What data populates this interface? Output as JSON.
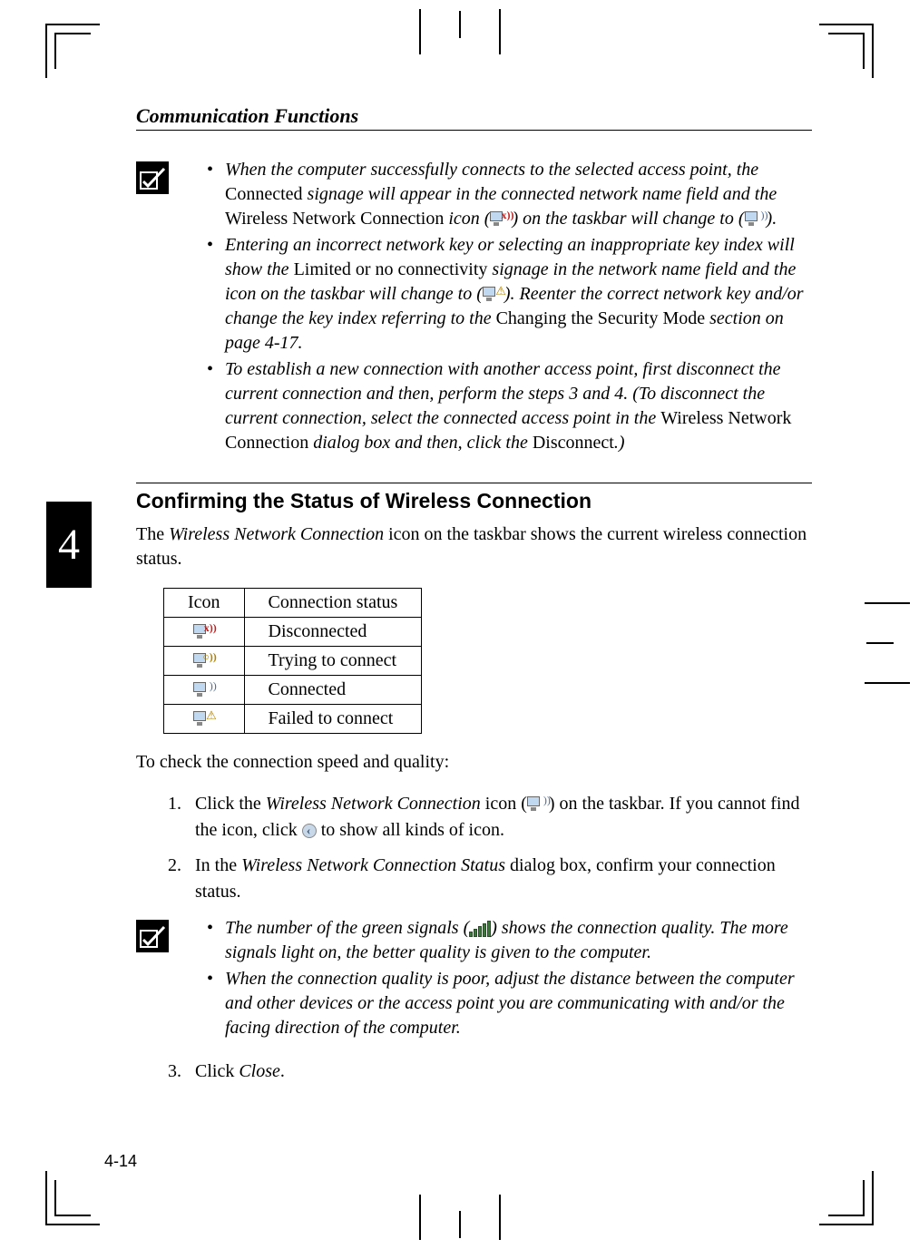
{
  "page_title": "Communication Functions",
  "chapter_number": "4",
  "page_number": "4-14",
  "note1": {
    "items": [
      {
        "pre": "When the computer successfully connects to the selected access point, the ",
        "nonItalic1": "Connected",
        "mid1": " signage will appear in the connected network name field and the ",
        "nonItalic2": "Wireless Network Connection",
        "mid2": " icon (",
        "mid3": ") on the taskbar will change to (",
        "mid4": ")."
      },
      {
        "pre": "Entering an incorrect network key or selecting an inappropriate key index will show the ",
        "nonItalic1": "Limited or no connectivity",
        "mid1": " signage in the network name field and the icon on the taskbar will change to (",
        "mid2": "). Reenter the correct network key and/or change the key index referring to the ",
        "nonItalic2": "Changing the Security Mode",
        "mid3": " section on page 4-17."
      },
      {
        "pre": "To establish a new connection with another access point, first disconnect the current connection and then, perform the steps 3 and 4. (To disconnect the current connection, select the connected access point in the ",
        "nonItalic1": "Wireless Network Connection",
        "mid1": " dialog box and then, click the ",
        "nonItalic2": "Disconnect",
        "mid2": ".)"
      }
    ]
  },
  "section_heading": "Confirming the Status of Wireless Connection",
  "intro_text": {
    "pre": "The ",
    "italic": "Wireless Network Connection",
    "post": " icon on the taskbar shows the current wireless connection status."
  },
  "table": {
    "headers": [
      "Icon",
      "Connection status"
    ],
    "rows": [
      {
        "icon": "disconnected",
        "text": "Disconnected"
      },
      {
        "icon": "trying",
        "text": "Trying to connect"
      },
      {
        "icon": "connected",
        "text": "Connected"
      },
      {
        "icon": "failed",
        "text": "Failed to connect"
      }
    ]
  },
  "check_text": "To check the connection speed and quality:",
  "steps": [
    {
      "pre": "Click the ",
      "italic1": "Wireless Network Connection",
      "mid1": " icon (",
      "mid2": ") on the taskbar. If you cannot find the icon, click ",
      "mid3": " to show all kinds of icon."
    },
    {
      "pre": "In the ",
      "italic1": "Wireless Network Connection Status",
      "mid1": " dialog box, confirm your connection status."
    }
  ],
  "note2": {
    "items": [
      {
        "pre": "The number of the green signals (",
        "post": ") shows the connection quality. The more signals light on, the better quality is given to the computer."
      },
      {
        "text": "When the connection quality is poor, adjust the distance between the computer and other devices or the access point you are communicating with and/or the facing direction of the computer."
      }
    ]
  },
  "step3": {
    "pre": "Click ",
    "italic": "Close",
    "post": "."
  }
}
